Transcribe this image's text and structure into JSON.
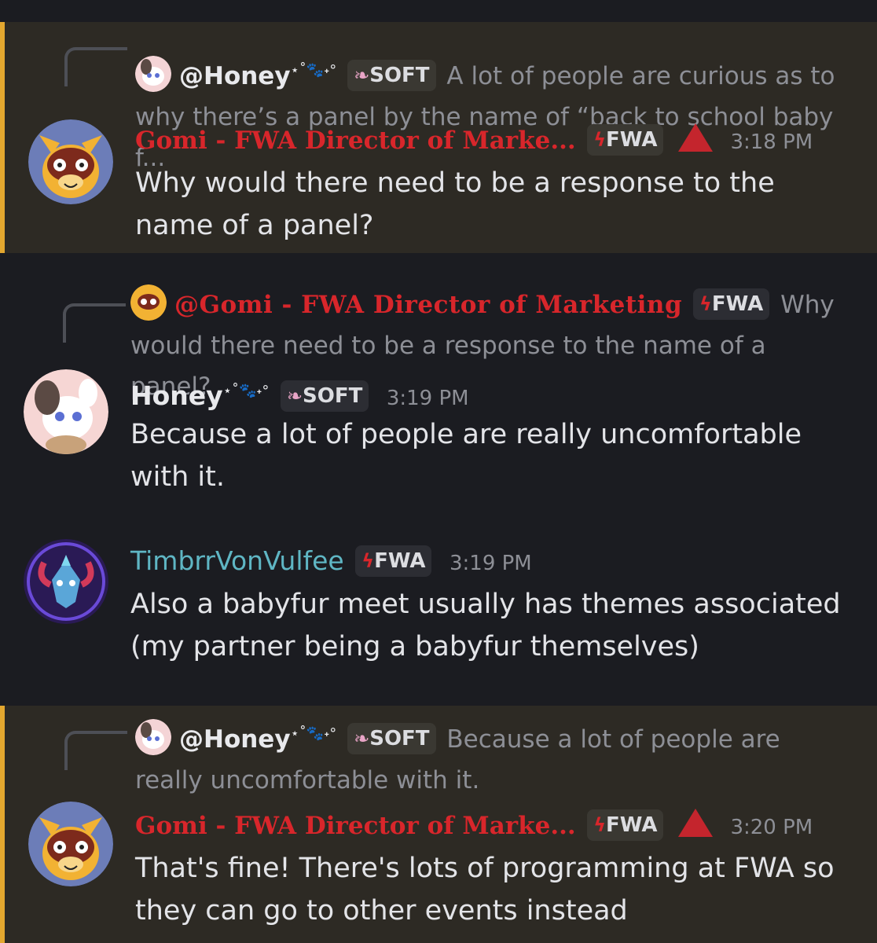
{
  "messages": [
    {
      "reply": {
        "name": "@Honey",
        "sparkles": "⋆˚🐾˖°",
        "tag": "SOFT",
        "text": "A lot of people are curious as to why there’s a panel by the name of “back to school baby f..."
      },
      "author": "Gomi - FWA Director of Marke...",
      "tag": "FWA",
      "time": "3:18 PM",
      "text": "Why would there need to be a response to the name of a panel?"
    },
    {
      "reply": {
        "name": "@Gomi - FWA Director of Marketing",
        "tag": "FWA",
        "text": "Why would there need to be a response to the name of a panel?"
      },
      "author": "Honey",
      "sparkles": "⋆˚🐾˖°",
      "tag": "SOFT",
      "time": "3:19 PM",
      "text": "Because a lot of people are really uncomfortable with it."
    },
    {
      "author": "TimbrrVonVulfee",
      "tag": "FWA",
      "time": "3:19 PM",
      "text": "Also a babyfur meet usually has themes associated (my partner being a babyfur themselves)"
    },
    {
      "reply": {
        "name": "@Honey",
        "sparkles": "⋆˚🐾˖°",
        "tag": "SOFT",
        "text": "Because a lot of people are really uncomfortable with it."
      },
      "author": "Gomi - FWA Director of Marke...",
      "tag": "FWA",
      "time": "3:20 PM",
      "text": "That's fine! There's lots of programming at FWA so they can go to other events instead"
    }
  ],
  "icons": {
    "soft_tag": "feather-icon",
    "fwa_tag": "lightning-icon",
    "role": "red-triangle-icon"
  },
  "colors": {
    "mention_bg": "#2d2a24",
    "mention_border": "#e3a72f",
    "gomi_name": "#d8262b",
    "timbrr_name": "#5fb6c4"
  }
}
